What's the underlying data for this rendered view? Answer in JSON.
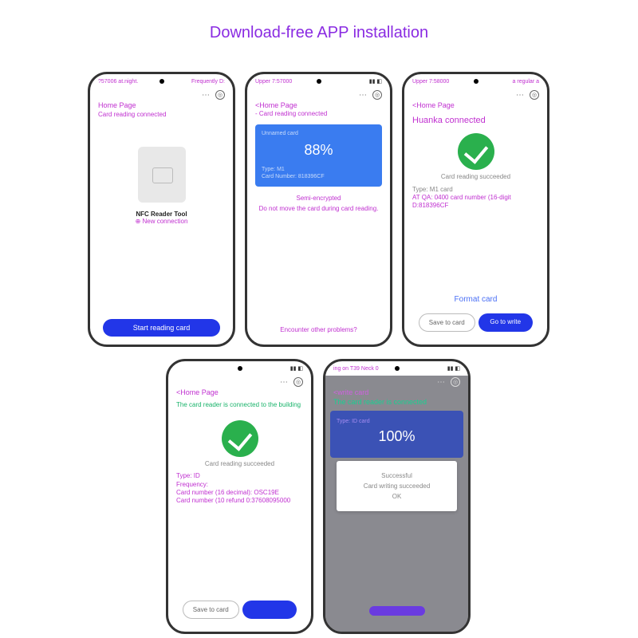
{
  "title": "Download-free APP installation",
  "phone1": {
    "status_left": "?57006 at.night.",
    "status_right": "Frequently D:",
    "home": "Home Page",
    "conn": "Card reading connected",
    "nfc_label": "NFC Reader Tool",
    "nfc_sub": "⊕ New connection",
    "btn": "Start reading card"
  },
  "phone2": {
    "status_left": "Upper 7:57000",
    "home": "<Home Page",
    "conn": "- Card reading connected",
    "card_title": "Unnamed card",
    "percent": "88%",
    "type": "Type: M1",
    "cardnum": "Card Number: 818396CF",
    "semi": "Semi-encrypted",
    "warn": "Do not move the card during card reading.",
    "problems": "Encounter other problems?"
  },
  "phone3": {
    "status_left": "Upper 7:58000",
    "status_right": "a regular a",
    "home": "<Home Page",
    "huanka": "Huanka connected",
    "succ": "Card reading succeeded",
    "type": "Type: M1 card",
    "atqa": "AT QA: 0400 card number (16-digit D:818396CF",
    "format": "Format card",
    "save": "Save to card",
    "go": "Go to write"
  },
  "phone4": {
    "home": "<Home Page",
    "conn": "The card reader is connected to the building",
    "succ": "Card reading succeeded",
    "info1": "Type: ID",
    "info2": "Frequency:",
    "info3": "Card number (16 decimal): OSC19E",
    "info4": "Card number (10 refund 0:37608095000",
    "save": "Save to card",
    "go": " "
  },
  "phone5": {
    "status_left": "ing on T39 Neck 0",
    "write": "<write card",
    "conn": "The card reader is connected",
    "percent": "100%",
    "type": "Type: ID card",
    "successful": "Successful",
    "writing": "Card writing succeeded",
    "ok": "OK",
    "btn": " "
  }
}
